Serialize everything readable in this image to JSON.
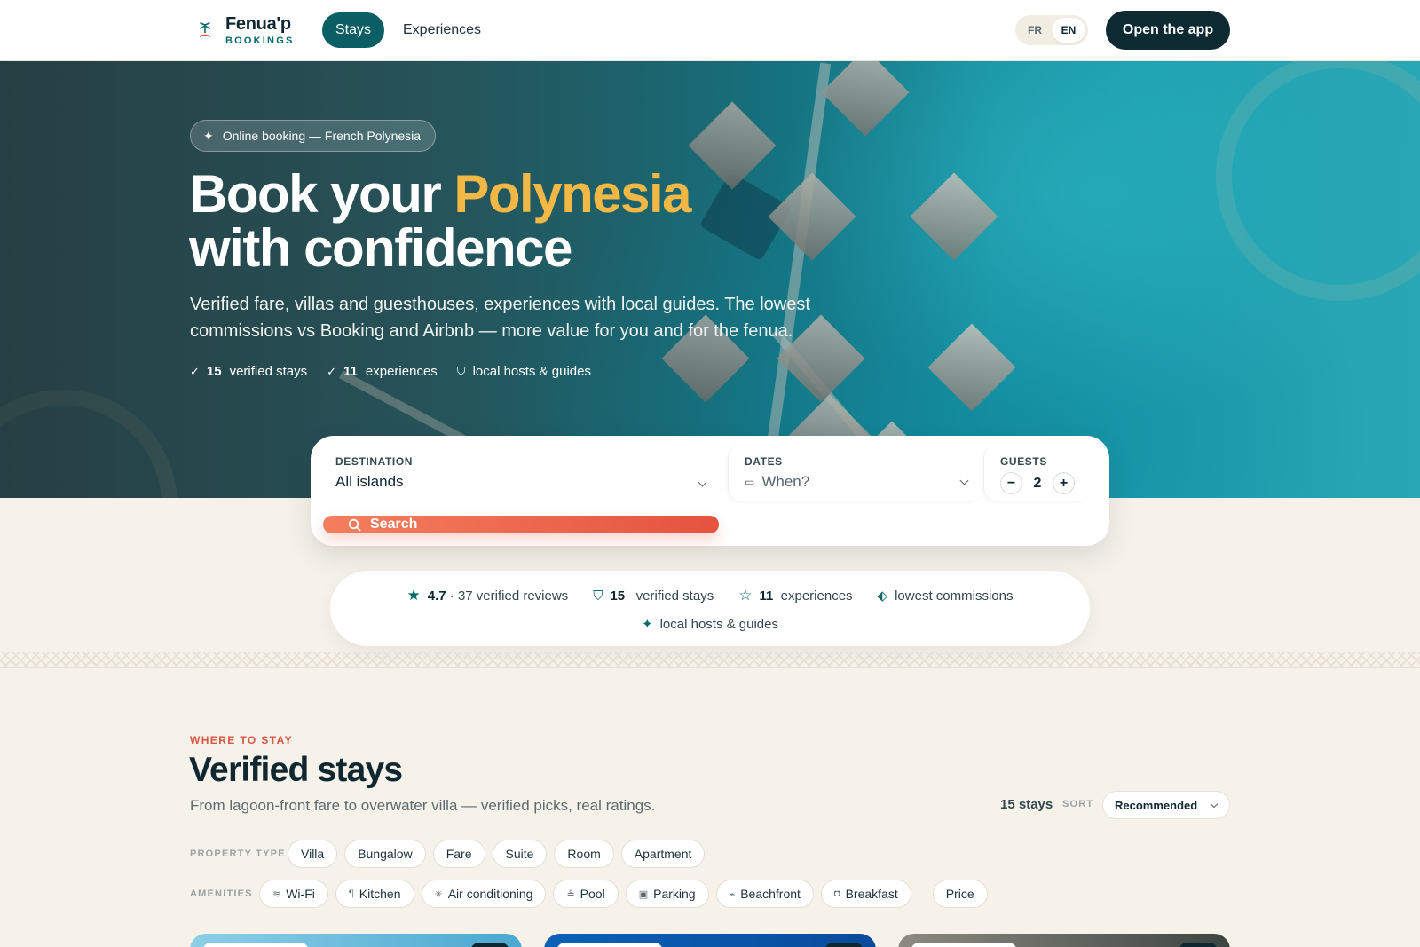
{
  "brand": {
    "name": "Fenua'p",
    "sub": "BOOKINGS"
  },
  "nav": {
    "stays": "Stays",
    "experiences": "Experiences"
  },
  "lang": {
    "fr": "FR",
    "en": "EN",
    "active": "EN"
  },
  "cta": {
    "open_app": "Open the app"
  },
  "hero": {
    "badge": "Online booking — French Polynesia",
    "title_part1": "Book your ",
    "title_accent": "Polynesia",
    "title_line2": "with confidence",
    "lead": "Verified fare, villas and guesthouses, experiences with local guides. The lowest commissions vs Booking and Airbnb — more value for you and for the fenua.",
    "stats": [
      {
        "number": "15",
        "label": "verified stays",
        "icon": "check-icon"
      },
      {
        "number": "11",
        "label": "experiences",
        "icon": "check-icon"
      },
      {
        "number": "",
        "label": "local hosts & guides",
        "icon": "shield-icon"
      }
    ]
  },
  "search": {
    "destination_label": "DESTINATION",
    "destination_value": "All islands",
    "dates_label": "DATES",
    "dates_placeholder": "When?",
    "guests_label": "GUESTS",
    "guests_value": "2",
    "minus": "−",
    "plus": "+",
    "button": "Search"
  },
  "trust": {
    "rating": "4.7",
    "reviews": "· 37 verified reviews",
    "stays_number": "15",
    "stays_label": "verified stays",
    "exp_number": "11",
    "exp_label": "experiences",
    "commissions": "lowest commissions",
    "hosts": "local hosts & guides"
  },
  "section": {
    "eyebrow": "WHERE TO STAY",
    "title": "Verified stays",
    "subtitle": "From lagoon-front fare to overwater villa — verified picks, real ratings.",
    "count": "15 stays",
    "sort_label": "SORT",
    "sort_value": "Recommended"
  },
  "filters": {
    "property_type_label": "PROPERTY TYPE",
    "property_types": [
      "Villa",
      "Bungalow",
      "Fare",
      "Suite",
      "Room",
      "Apartment"
    ],
    "amenities_label": "AMENITIES",
    "amenities": [
      {
        "label": "Wi-Fi",
        "icon": "wifi-icon",
        "glyph": "≋"
      },
      {
        "label": "Kitchen",
        "icon": "utensils-icon",
        "glyph": "¶"
      },
      {
        "label": "Air conditioning",
        "icon": "snowflake-icon",
        "glyph": "✳"
      },
      {
        "label": "Pool",
        "icon": "pool-icon",
        "glyph": "≗"
      },
      {
        "label": "Parking",
        "icon": "parking-icon",
        "glyph": "▣"
      },
      {
        "label": "Beachfront",
        "icon": "umbrella-icon",
        "glyph": "⌁"
      },
      {
        "label": "Breakfast",
        "icon": "coffee-icon",
        "glyph": "◘"
      }
    ],
    "price": "Price"
  },
  "colors": {
    "primary": "#0b5e63",
    "accent": "#f2b846",
    "cta": "#e5533f",
    "dark": "#0d2a33"
  }
}
